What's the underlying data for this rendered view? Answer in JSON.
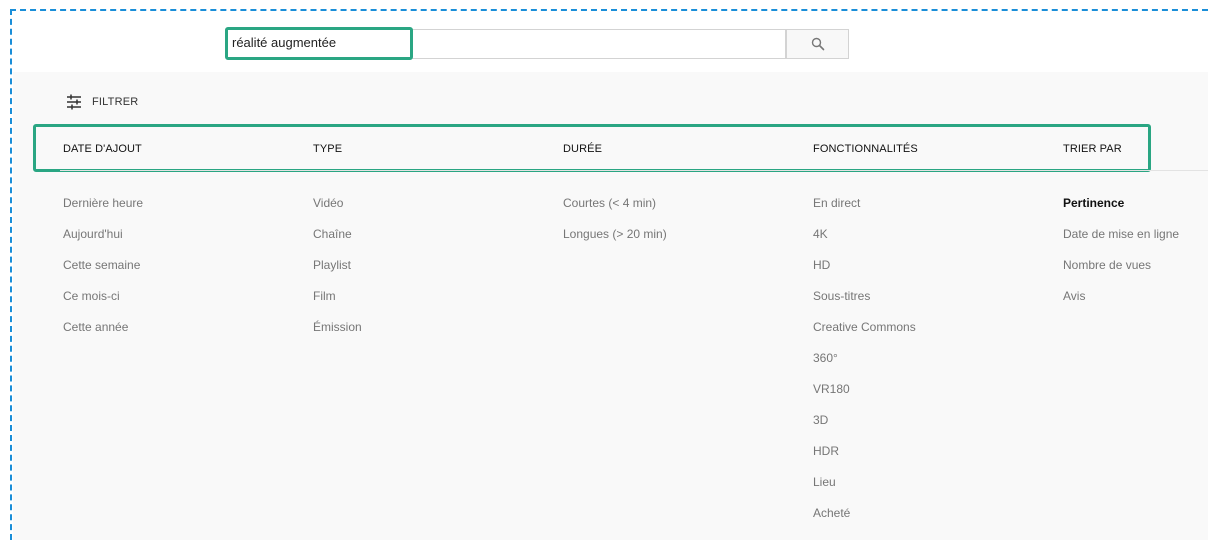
{
  "search": {
    "query": "réalité augmentée",
    "button_icon": "search-icon"
  },
  "filter_toggle": {
    "label": "FILTRER",
    "icon": "sliders-icon"
  },
  "groups": [
    {
      "heading": "DATE D'AJOUT",
      "options": [
        "Dernière heure",
        "Aujourd'hui",
        "Cette semaine",
        "Ce mois-ci",
        "Cette année"
      ]
    },
    {
      "heading": "TYPE",
      "options": [
        "Vidéo",
        "Chaîne",
        "Playlist",
        "Film",
        "Émission"
      ]
    },
    {
      "heading": "DURÉE",
      "options": [
        "Courtes (< 4 min)",
        "Longues (> 20 min)"
      ]
    },
    {
      "heading": "FONCTIONNALITÉS",
      "options": [
        "En direct",
        "4K",
        "HD",
        "Sous-titres",
        "Creative Commons",
        "360°",
        "VR180",
        "3D",
        "HDR",
        "Lieu",
        "Acheté"
      ]
    },
    {
      "heading": "TRIER PAR",
      "options": [
        "Pertinence",
        "Date de mise en ligne",
        "Nombre de vues",
        "Avis"
      ],
      "selected": "Pertinence"
    }
  ],
  "colors": {
    "highlight": "#2aa683",
    "dashed_border": "#1a8ed8",
    "option_text": "#767676",
    "heading_text": "#111111"
  }
}
